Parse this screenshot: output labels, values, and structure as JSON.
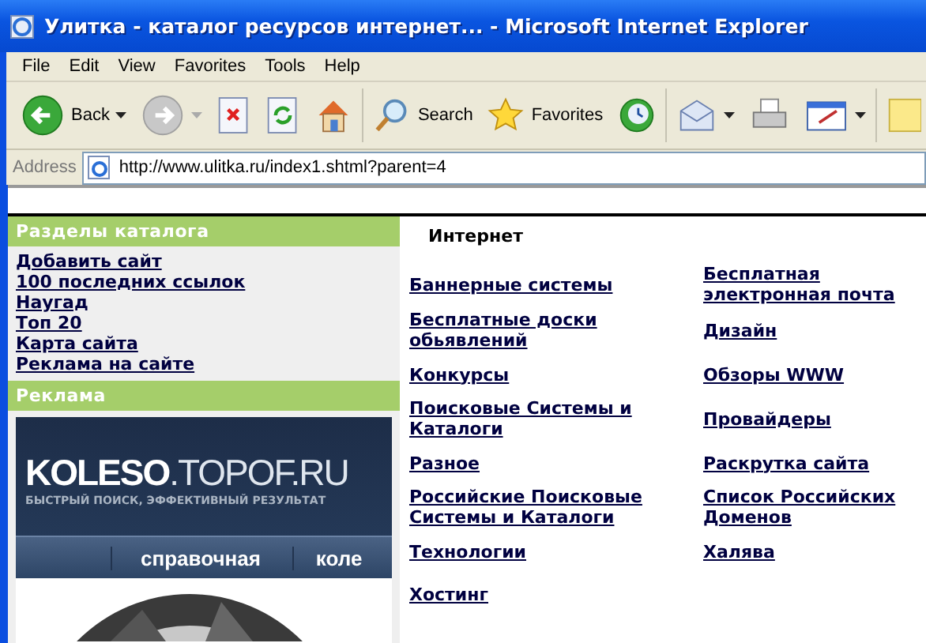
{
  "window": {
    "title": "Улитка - каталог ресурсов интернет... - Microsoft Internet Explorer"
  },
  "menu": [
    "File",
    "Edit",
    "View",
    "Favorites",
    "Tools",
    "Help"
  ],
  "toolbar": [
    {
      "kind": "back",
      "label": "Back",
      "disabled": false
    },
    {
      "kind": "forward",
      "disabled": true
    },
    {
      "kind": "stop"
    },
    {
      "kind": "refresh"
    },
    {
      "kind": "home"
    },
    {
      "kind": "sep"
    },
    {
      "kind": "search",
      "label": "Search"
    },
    {
      "kind": "favorites",
      "label": "Favorites"
    },
    {
      "kind": "history"
    },
    {
      "kind": "sep"
    },
    {
      "kind": "mail"
    },
    {
      "kind": "print"
    },
    {
      "kind": "edit"
    },
    {
      "kind": "sep"
    },
    {
      "kind": "note"
    }
  ],
  "address": {
    "label": "Address",
    "value": "http://www.ulitka.ru/index1.shtml?parent=4"
  },
  "sidebar": {
    "heading": "Разделы каталога",
    "links": [
      "Добавить сайт",
      "100 последних ссылок",
      "Наугад",
      "Топ 20",
      "Карта сайта",
      "Реклама на сайте"
    ],
    "ad_heading": "Реклама",
    "banner": {
      "logo_bold": "KOLESO",
      "logo_rest": ".TOPOF.RU",
      "tagline": "БЫСТРЫЙ ПОИСК, ЭФФЕКТИВНЫЙ РЕЗУЛЬТАТ",
      "tabs": [
        "справочная",
        "коле"
      ]
    }
  },
  "content": {
    "heading": "Интернет",
    "links": [
      [
        "Баннерные системы",
        "Бесплатная электронная почта"
      ],
      [
        "Бесплатные доски обьявлений",
        "Дизайн"
      ],
      [
        "Конкурсы",
        "Обзоры WWW"
      ],
      [
        "Поисковые Системы и Каталоги",
        "Провайдеры"
      ],
      [
        "Разное",
        "Раскрутка сайта"
      ],
      [
        "Российские Поисковые Системы и Каталоги",
        "Список Российских Доменов"
      ],
      [
        "Технологии",
        "Халява"
      ],
      [
        "Хостинг"
      ]
    ]
  }
}
